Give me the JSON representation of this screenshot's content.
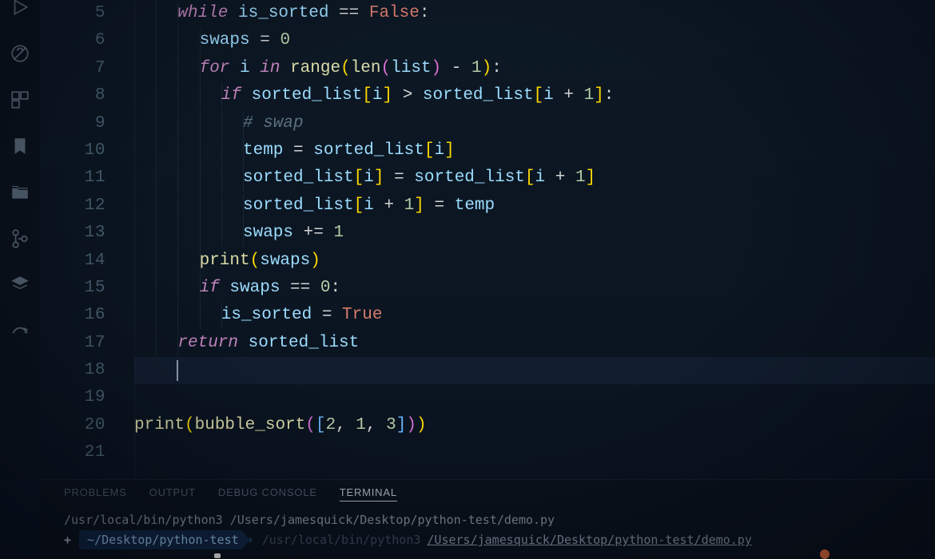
{
  "sidebar": {
    "icons": [
      "debug-alt",
      "bug-disabled",
      "extensions",
      "bookmark",
      "files",
      "source-control",
      "layers",
      "share"
    ]
  },
  "editor": {
    "first_line_number": 5,
    "lines": [
      {
        "n": "5",
        "i": 2,
        "t": [
          [
            "kw",
            "while"
          ],
          [
            "txt",
            " "
          ],
          [
            "var",
            "is_sorted"
          ],
          [
            "txt",
            " "
          ],
          [
            "op",
            "=="
          ],
          [
            "txt",
            " "
          ],
          [
            "bool",
            "False"
          ],
          [
            "punc",
            ":"
          ]
        ]
      },
      {
        "n": "6",
        "i": 3,
        "t": [
          [
            "var",
            "swaps"
          ],
          [
            "txt",
            " "
          ],
          [
            "op",
            "="
          ],
          [
            "txt",
            " "
          ],
          [
            "num",
            "0"
          ]
        ]
      },
      {
        "n": "7",
        "i": 3,
        "t": [
          [
            "kw",
            "for"
          ],
          [
            "txt",
            " "
          ],
          [
            "var",
            "i"
          ],
          [
            "txt",
            " "
          ],
          [
            "kw",
            "in"
          ],
          [
            "txt",
            " "
          ],
          [
            "fn",
            "range"
          ],
          [
            "br1",
            "("
          ],
          [
            "fn",
            "len"
          ],
          [
            "br2",
            "("
          ],
          [
            "var",
            "list"
          ],
          [
            "br2",
            ")"
          ],
          [
            "txt",
            " "
          ],
          [
            "op",
            "-"
          ],
          [
            "txt",
            " "
          ],
          [
            "num",
            "1"
          ],
          [
            "br1",
            ")"
          ],
          [
            "punc",
            ":"
          ]
        ]
      },
      {
        "n": "8",
        "i": 4,
        "t": [
          [
            "kw",
            "if"
          ],
          [
            "txt",
            " "
          ],
          [
            "var",
            "sorted_list"
          ],
          [
            "br1",
            "["
          ],
          [
            "var",
            "i"
          ],
          [
            "br1",
            "]"
          ],
          [
            "txt",
            " "
          ],
          [
            "op",
            ">"
          ],
          [
            "txt",
            " "
          ],
          [
            "var",
            "sorted_list"
          ],
          [
            "br1",
            "["
          ],
          [
            "var",
            "i"
          ],
          [
            "txt",
            " "
          ],
          [
            "op",
            "+"
          ],
          [
            "txt",
            " "
          ],
          [
            "num",
            "1"
          ],
          [
            "br1",
            "]"
          ],
          [
            "punc",
            ":"
          ]
        ]
      },
      {
        "n": "9",
        "i": 5,
        "t": [
          [
            "cmt",
            "# swap"
          ]
        ]
      },
      {
        "n": "10",
        "i": 5,
        "t": [
          [
            "var",
            "temp"
          ],
          [
            "txt",
            " "
          ],
          [
            "op",
            "="
          ],
          [
            "txt",
            " "
          ],
          [
            "var",
            "sorted_list"
          ],
          [
            "br1",
            "["
          ],
          [
            "var",
            "i"
          ],
          [
            "br1",
            "]"
          ]
        ]
      },
      {
        "n": "11",
        "i": 5,
        "t": [
          [
            "var",
            "sorted_list"
          ],
          [
            "br1",
            "["
          ],
          [
            "var",
            "i"
          ],
          [
            "br1",
            "]"
          ],
          [
            "txt",
            " "
          ],
          [
            "op",
            "="
          ],
          [
            "txt",
            " "
          ],
          [
            "var",
            "sorted_list"
          ],
          [
            "br1",
            "["
          ],
          [
            "var",
            "i"
          ],
          [
            "txt",
            " "
          ],
          [
            "op",
            "+"
          ],
          [
            "txt",
            " "
          ],
          [
            "num",
            "1"
          ],
          [
            "br1",
            "]"
          ]
        ]
      },
      {
        "n": "12",
        "i": 5,
        "t": [
          [
            "var",
            "sorted_list"
          ],
          [
            "br1",
            "["
          ],
          [
            "var",
            "i"
          ],
          [
            "txt",
            " "
          ],
          [
            "op",
            "+"
          ],
          [
            "txt",
            " "
          ],
          [
            "num",
            "1"
          ],
          [
            "br1",
            "]"
          ],
          [
            "txt",
            " "
          ],
          [
            "op",
            "="
          ],
          [
            "txt",
            " "
          ],
          [
            "var",
            "temp"
          ]
        ]
      },
      {
        "n": "13",
        "i": 5,
        "t": [
          [
            "var",
            "swaps"
          ],
          [
            "txt",
            " "
          ],
          [
            "op",
            "+="
          ],
          [
            "txt",
            " "
          ],
          [
            "num",
            "1"
          ]
        ]
      },
      {
        "n": "14",
        "i": 3,
        "t": [
          [
            "fn",
            "print"
          ],
          [
            "br1",
            "("
          ],
          [
            "var",
            "swaps"
          ],
          [
            "br1",
            ")"
          ]
        ]
      },
      {
        "n": "15",
        "i": 3,
        "t": [
          [
            "kw",
            "if"
          ],
          [
            "txt",
            " "
          ],
          [
            "var",
            "swaps"
          ],
          [
            "txt",
            " "
          ],
          [
            "op",
            "=="
          ],
          [
            "txt",
            " "
          ],
          [
            "num",
            "0"
          ],
          [
            "punc",
            ":"
          ]
        ]
      },
      {
        "n": "16",
        "i": 4,
        "t": [
          [
            "var",
            "is_sorted"
          ],
          [
            "txt",
            " "
          ],
          [
            "op",
            "="
          ],
          [
            "txt",
            " "
          ],
          [
            "bool",
            "True"
          ]
        ]
      },
      {
        "n": "17",
        "i": 2,
        "t": [
          [
            "kw",
            "return"
          ],
          [
            "txt",
            " "
          ],
          [
            "var",
            "sorted_list"
          ]
        ]
      },
      {
        "n": "18",
        "i": 0,
        "current": true,
        "t": []
      },
      {
        "n": "19",
        "i": 0,
        "t": []
      },
      {
        "n": "20",
        "i": 0,
        "t": [
          [
            "fn",
            "print"
          ],
          [
            "br1",
            "("
          ],
          [
            "fn",
            "bubble_sort"
          ],
          [
            "br2",
            "("
          ],
          [
            "br3",
            "["
          ],
          [
            "num",
            "2"
          ],
          [
            "punc",
            ","
          ],
          [
            "txt",
            " "
          ],
          [
            "num",
            "1"
          ],
          [
            "punc",
            ","
          ],
          [
            "txt",
            " "
          ],
          [
            "num",
            "3"
          ],
          [
            "br3",
            "]"
          ],
          [
            "br2",
            ")"
          ],
          [
            "br1",
            ")"
          ]
        ]
      },
      {
        "n": "21",
        "i": 0,
        "t": []
      }
    ]
  },
  "panel": {
    "tabs": [
      {
        "label": "PROBLEMS",
        "active": false
      },
      {
        "label": "OUTPUT",
        "active": false
      },
      {
        "label": "DEBUG CONSOLE",
        "active": false
      },
      {
        "label": "TERMINAL",
        "active": true
      }
    ],
    "term_line1": "/usr/local/bin/python3 /Users/jamesquick/Desktop/python-test/demo.py",
    "prompt_plus": "+",
    "prompt_dir": "~/Desktop/python-test",
    "prompt_arrow": "›",
    "prompt_interpreter": "/usr/local/bin/python3",
    "prompt_filepath": "/Users/jamesquick/Desktop/python-test/demo.py"
  }
}
